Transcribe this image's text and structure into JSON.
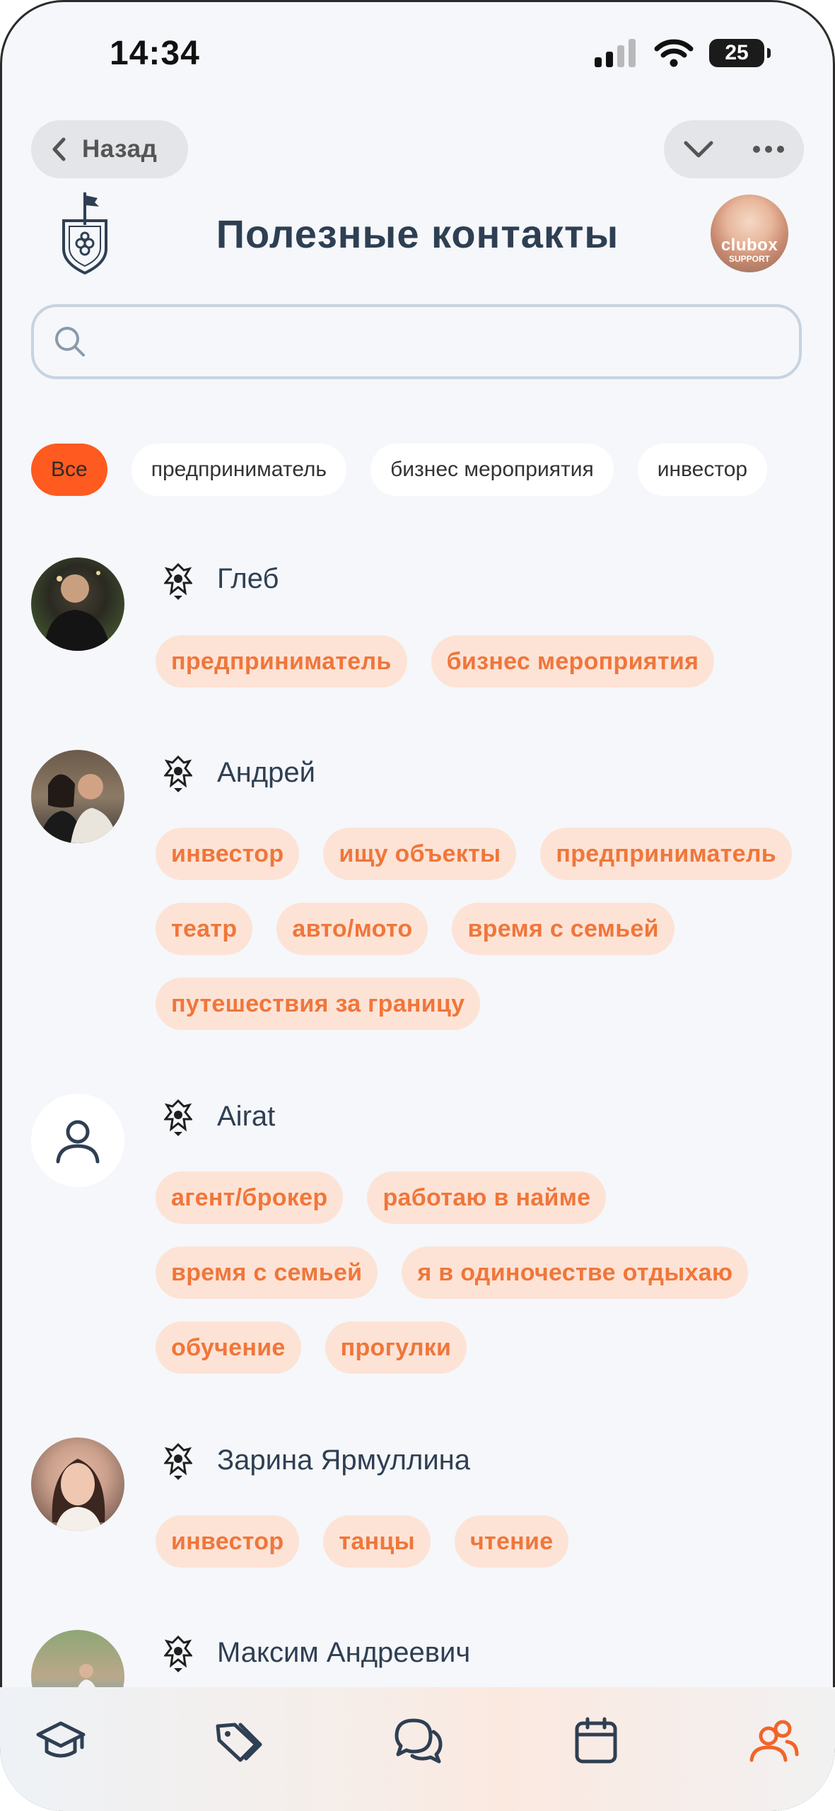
{
  "status_bar": {
    "time": "14:34",
    "battery": "25"
  },
  "nav": {
    "back_label": "Назад"
  },
  "header": {
    "title": "Полезные контакты",
    "support_brand": "clubox",
    "support_sub": "SUPPORT"
  },
  "search": {
    "placeholder": "",
    "value": ""
  },
  "filters": [
    "Все",
    "предприниматель",
    "бизнес мероприятия",
    "инвестор"
  ],
  "contacts": [
    {
      "name": "Глеб",
      "tags": [
        "предприниматель",
        "бизнес мероприятия"
      ]
    },
    {
      "name": "Андрей",
      "tags": [
        "инвестор",
        "ищу объекты",
        "предприниматель",
        "театр",
        "авто/мото",
        "время с семьей",
        "путешествия за границу"
      ]
    },
    {
      "name": "Airat",
      "tags": [
        "агент/брокер",
        "работаю в найме",
        "время с семьей",
        "я в одиночестве отдыхаю",
        "обучение",
        "прогулки"
      ]
    },
    {
      "name": "Зарина Ярмуллина",
      "tags": [
        "инвестор",
        "танцы",
        "чтение"
      ]
    },
    {
      "name": "Максим Андреевич",
      "tags": []
    }
  ],
  "colors": {
    "accent": "#ff5a1f",
    "tag_bg": "#fde3d6",
    "tag_text": "#f0763a",
    "title": "#2f3f53"
  },
  "bottom_nav": [
    "graduation-cap-icon",
    "tags-icon",
    "chat-icon",
    "calendar-icon",
    "contacts-icon"
  ]
}
